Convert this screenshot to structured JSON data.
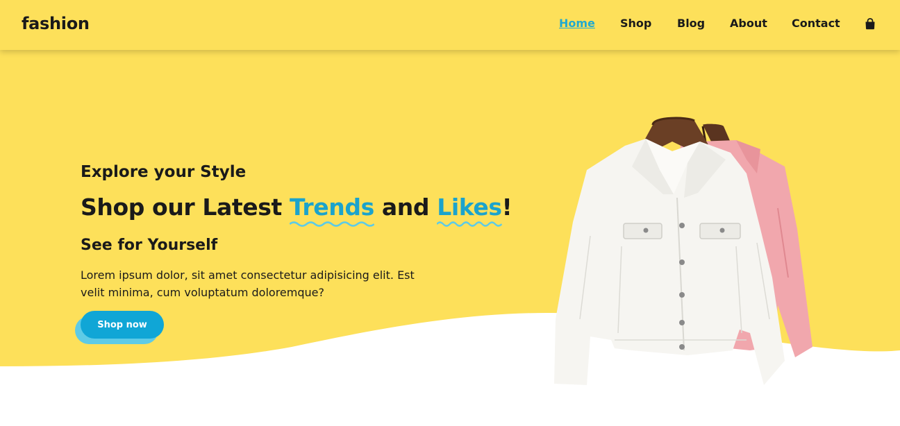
{
  "header": {
    "logo": "fashion",
    "nav": [
      {
        "label": "Home",
        "active": true
      },
      {
        "label": "Shop",
        "active": false
      },
      {
        "label": "Blog",
        "active": false
      },
      {
        "label": "About",
        "active": false
      },
      {
        "label": "Contact",
        "active": false
      }
    ],
    "cart_icon": "shopping-bag-icon"
  },
  "hero": {
    "eyebrow": "Explore your Style",
    "headline": {
      "part1": "Shop our Latest ",
      "highlight1": "Trends",
      "part2": " and ",
      "highlight2": "Likes",
      "part3": "!"
    },
    "subhead": "See for Yourself",
    "description": "Lorem ipsum dolor, sit amet consectetur adipisicing elit. Est velit minima, cum voluptatum doloremque?",
    "cta_label": "Shop now",
    "image": "jackets-on-hangers-image"
  },
  "colors": {
    "background_yellow": "#fde05a",
    "accent_blue": "#10a6d6",
    "highlight_blue": "#1ba3cc",
    "text": "#1a1a1a"
  }
}
